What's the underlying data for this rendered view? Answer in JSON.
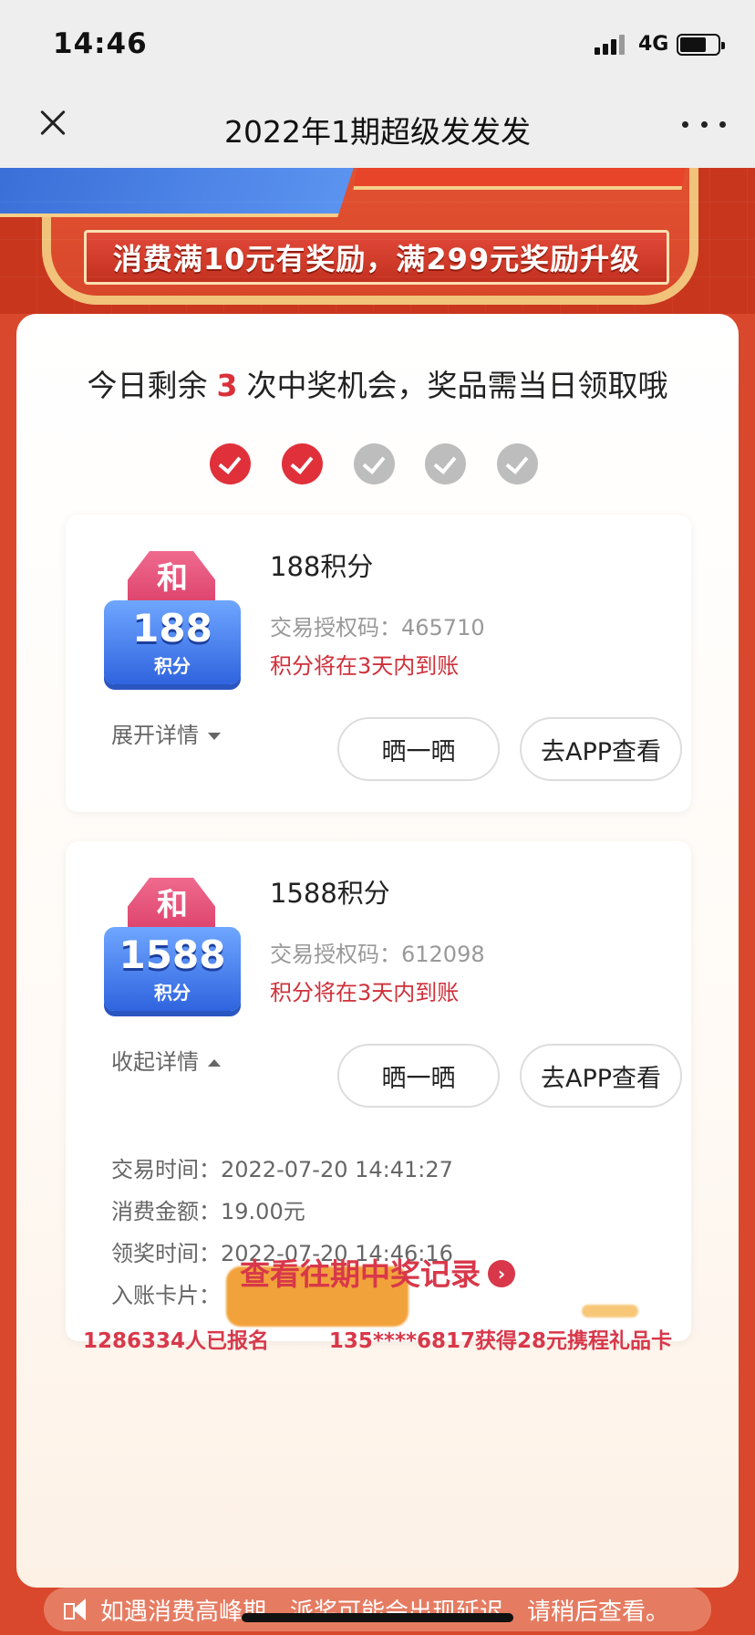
{
  "status": {
    "time": "14:46",
    "network": "4G"
  },
  "nav": {
    "title": "2022年1期超级发发发"
  },
  "banner": {
    "text": "消费满10元有奖励，满299元奖励升级"
  },
  "main": {
    "remaining_prefix": "今日剩余",
    "remaining_count": "3",
    "remaining_suffix": "次中奖机会，奖品需当日领取哦",
    "chances": [
      true,
      true,
      false,
      false,
      false
    ]
  },
  "prizes": [
    {
      "badge_top": "和",
      "badge_number": "188",
      "badge_unit": "积分",
      "title": "188积分",
      "code_label": "交易授权码：",
      "code": "465710",
      "note": "积分将在3天内到账",
      "toggle_label": "展开详情",
      "share_label": "晒一晒",
      "app_label": "去APP查看"
    },
    {
      "badge_top": "和",
      "badge_number": "1588",
      "badge_unit": "积分",
      "title": "1588积分",
      "code_label": "交易授权码：",
      "code": "612098",
      "note": "积分将在3天内到账",
      "toggle_label": "收起详情",
      "share_label": "晒一晒",
      "app_label": "去APP查看",
      "details": [
        {
          "label": "交易时间：",
          "value": "2022-07-20 14:41:27"
        },
        {
          "label": "消费金额：",
          "value": "19.00元"
        },
        {
          "label": "领奖时间：",
          "value": "2022-07-20 14:46:16"
        },
        {
          "label": "入账卡片：",
          "value": ""
        }
      ]
    }
  ],
  "history_link": "查看往期中奖记录",
  "stats": {
    "signups": "1286334人已报名",
    "winner": "135****6817获得28元携程礼品卡"
  },
  "notice": "如遇消费高峰期，派奖可能会出现延迟，请稍后查看。",
  "colors": {
    "accent_red": "#d9303a",
    "bg_red": "#d9482c",
    "badge_blue": "#2f64df"
  }
}
